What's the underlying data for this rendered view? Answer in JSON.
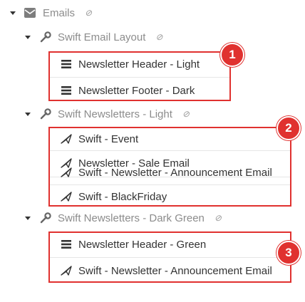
{
  "root": {
    "label": "Emails"
  },
  "groups": [
    {
      "label": "Swift Email Layout",
      "badge": "1",
      "items": [
        "Newsletter Header - Light",
        "Newsletter Footer - Dark"
      ]
    },
    {
      "label": "Swift Newsletters - Light",
      "badge": "2",
      "items": [
        "Swift - Event",
        "Newsletter - Sale Email",
        "Swift - Newsletter - Announcement Email",
        "Swift - BlackFriday"
      ]
    },
    {
      "label": "Swift Newsletters - Dark Green",
      "badge": "3",
      "items": [
        "Newsletter Header - Green",
        "Swift - Newsletter - Announcement Email"
      ]
    }
  ],
  "colors": {
    "accent": "#e0312f",
    "muted_text": "#8c8c8c",
    "text": "#333333"
  },
  "icons": {
    "root": "envelope-icon",
    "group": "wrench-icon",
    "visibility": "eye-slash-icon",
    "layout_item": "list-icon",
    "email_item": "send-icon"
  }
}
